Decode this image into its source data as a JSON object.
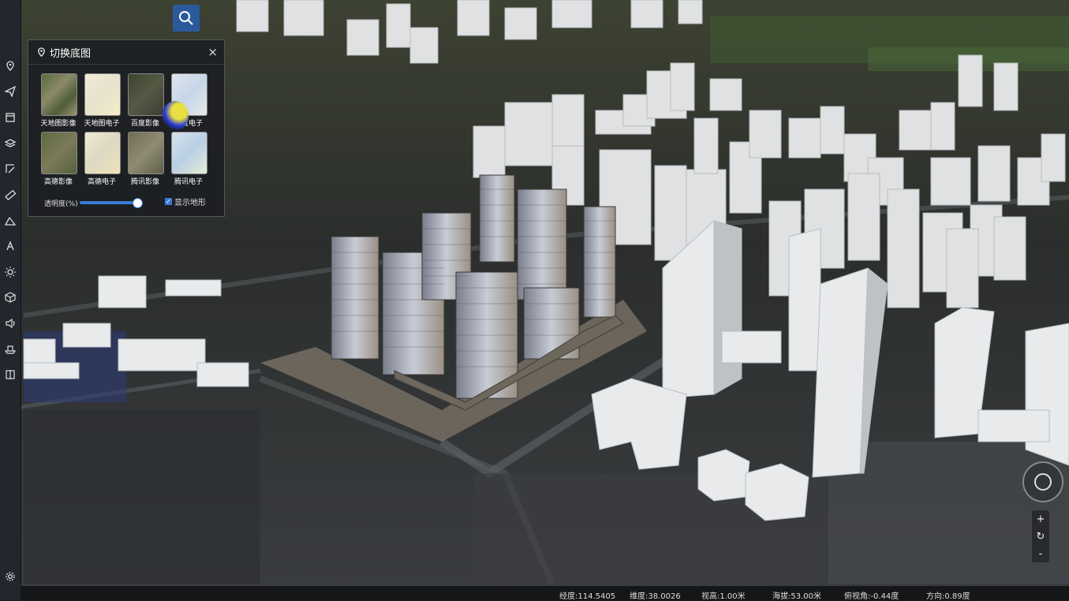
{
  "panel": {
    "title": "切换底图",
    "close_label": "×",
    "tiles": [
      {
        "label": "天地图影像",
        "style": "sat"
      },
      {
        "label": "天地图电子",
        "style": "map"
      },
      {
        "label": "百度影像",
        "style": "dark"
      },
      {
        "label": "百度电子",
        "style": "mapblue"
      },
      {
        "label": "高德影像",
        "style": "sat"
      },
      {
        "label": "高德电子",
        "style": "map"
      },
      {
        "label": "腾讯影像",
        "style": "sat2"
      },
      {
        "label": "腾讯电子",
        "style": "mapblue"
      }
    ],
    "opacity_label": "透明度(%)",
    "opacity_value": 1.0,
    "terrain_label": "显示地形",
    "terrain_checked": true
  },
  "status": {
    "longitude": "经度:114.5405",
    "latitude": "维度:38.0026",
    "view_height": "视高:1.00米",
    "altitude": "海拔:53.00米",
    "pitch": "俯视角:-0.44度",
    "heading": "方向:0.89度"
  },
  "nav": {
    "zoom_in": "+",
    "reset": "↻",
    "zoom_out": "-"
  },
  "sidebar": {
    "items": [
      "pin-map-icon",
      "send-icon",
      "panel-icon",
      "layers-icon",
      "draw-icon",
      "ruler-icon",
      "area-icon",
      "height-icon",
      "light-icon",
      "cube-icon",
      "sound-icon",
      "ship-icon",
      "split-icon"
    ],
    "settings": "gear-icon"
  },
  "colors": {
    "accent": "#3a7bd5",
    "panel_bg": "#1c1e22",
    "search_bg": "#2a5a9c"
  }
}
